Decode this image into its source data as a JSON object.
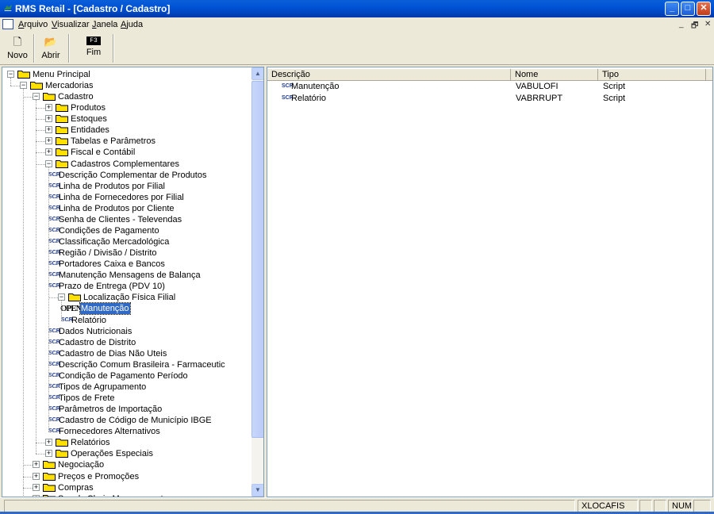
{
  "window": {
    "title": "RMS Retail - [Cadastro / Cadastro]",
    "minimize": "_",
    "maximize": "□",
    "close": "✕"
  },
  "menu": {
    "items": [
      "Arquivo",
      "Visualizar",
      "Janela",
      "Ajuda"
    ],
    "mdi_minimize": "_",
    "mdi_restore": "🗗",
    "mdi_close": "✕"
  },
  "toolbar": {
    "buttons": [
      {
        "label": "Novo",
        "icon": "new-document-icon",
        "glyph": "🗋"
      },
      {
        "label": "Abrir",
        "icon": "open-folder-icon",
        "glyph": "📂"
      },
      {
        "label": "Fim",
        "icon": "f3-key-icon",
        "glyph": "F3"
      }
    ]
  },
  "tree": {
    "items": [
      {
        "label": "Menu Principal",
        "level": 0,
        "type": "folder",
        "expander": "−"
      },
      {
        "label": "Mercadorias",
        "level": 1,
        "type": "folder",
        "expander": "−"
      },
      {
        "label": "Cadastro",
        "level": 2,
        "type": "folder",
        "expander": "−"
      },
      {
        "label": "Produtos",
        "level": 3,
        "type": "folder",
        "expander": "+"
      },
      {
        "label": "Estoques",
        "level": 3,
        "type": "folder",
        "expander": "+"
      },
      {
        "label": "Entidades",
        "level": 3,
        "type": "folder",
        "expander": "+"
      },
      {
        "label": "Tabelas e Parâmetros",
        "level": 3,
        "type": "folder",
        "expander": "+"
      },
      {
        "label": "Fiscal e Contábil",
        "level": 3,
        "type": "folder",
        "expander": "+"
      },
      {
        "label": "Cadastros Complementares",
        "level": 3,
        "type": "folder",
        "expander": "−"
      },
      {
        "label": "Descrição Complementar de Produtos",
        "level": 4,
        "type": "script"
      },
      {
        "label": "Linha de Produtos por Filial",
        "level": 4,
        "type": "script"
      },
      {
        "label": "Linha de Fornecedores por Filial",
        "level": 4,
        "type": "script"
      },
      {
        "label": "Linha de Produtos por Cliente",
        "level": 4,
        "type": "script"
      },
      {
        "label": "Senha de Clientes - Televendas",
        "level": 4,
        "type": "script"
      },
      {
        "label": "Condições de Pagamento",
        "level": 4,
        "type": "script"
      },
      {
        "label": "Classificação Mercadológica",
        "level": 4,
        "type": "script"
      },
      {
        "label": "Região / Divisão / Distrito",
        "level": 4,
        "type": "script"
      },
      {
        "label": "Portadores Caixa e Bancos",
        "level": 4,
        "type": "script"
      },
      {
        "label": "Manutenção Mensagens de Balança",
        "level": 4,
        "type": "script"
      },
      {
        "label": "Prazo de Entrega (PDV 10)",
        "level": 4,
        "type": "script"
      },
      {
        "label": "Localização Física Filial",
        "level": 4,
        "type": "folder",
        "expander": "−"
      },
      {
        "label": "Manutenção",
        "level": 5,
        "type": "open",
        "selected": true
      },
      {
        "label": "Relatório",
        "level": 5,
        "type": "script"
      },
      {
        "label": "Dados Nutricionais",
        "level": 4,
        "type": "script"
      },
      {
        "label": "Cadastro de Distrito",
        "level": 4,
        "type": "script"
      },
      {
        "label": "Cadastro de Dias Não Uteis",
        "level": 4,
        "type": "script"
      },
      {
        "label": "Descrição Comum Brasileira - Farmaceutic",
        "level": 4,
        "type": "script"
      },
      {
        "label": "Condição de Pagamento Período",
        "level": 4,
        "type": "script"
      },
      {
        "label": "Tipos de Agrupamento",
        "level": 4,
        "type": "script"
      },
      {
        "label": "Tipos de Frete",
        "level": 4,
        "type": "script"
      },
      {
        "label": "Parâmetros de Importação",
        "level": 4,
        "type": "script"
      },
      {
        "label": "Cadastro de Código de Município IBGE",
        "level": 4,
        "type": "script"
      },
      {
        "label": "Fornecedores Alternativos",
        "level": 4,
        "type": "script"
      },
      {
        "label": "Relatórios",
        "level": 3,
        "type": "folder",
        "expander": "+"
      },
      {
        "label": "Operações Especiais",
        "level": 3,
        "type": "folder",
        "expander": "+"
      },
      {
        "label": "Negociação",
        "level": 2,
        "type": "folder",
        "expander": "+"
      },
      {
        "label": "Preços e Promoções",
        "level": 2,
        "type": "folder",
        "expander": "+"
      },
      {
        "label": "Compras",
        "level": 2,
        "type": "folder",
        "expander": "+"
      },
      {
        "label": "Supply Chain Management",
        "level": 2,
        "type": "folder",
        "expander": "+"
      }
    ],
    "open_glyph": "OPEN",
    "script_glyph": "SCR",
    "scroll_up": "▲",
    "scroll_down": "▼"
  },
  "list": {
    "columns": [
      "Descrição",
      "Nome",
      "Tipo"
    ],
    "rows": [
      {
        "descricao": "Manutenção",
        "nome": "VABULOFI",
        "tipo": "Script"
      },
      {
        "descricao": "Relatório",
        "nome": "VABRRUPT",
        "tipo": "Script"
      }
    ]
  },
  "status": {
    "user": "XLOCAFIS",
    "num": "NUM"
  },
  "colors": {
    "selection": "#316ac5",
    "folder": "#ffe000",
    "titlebar": "#0053d6"
  }
}
